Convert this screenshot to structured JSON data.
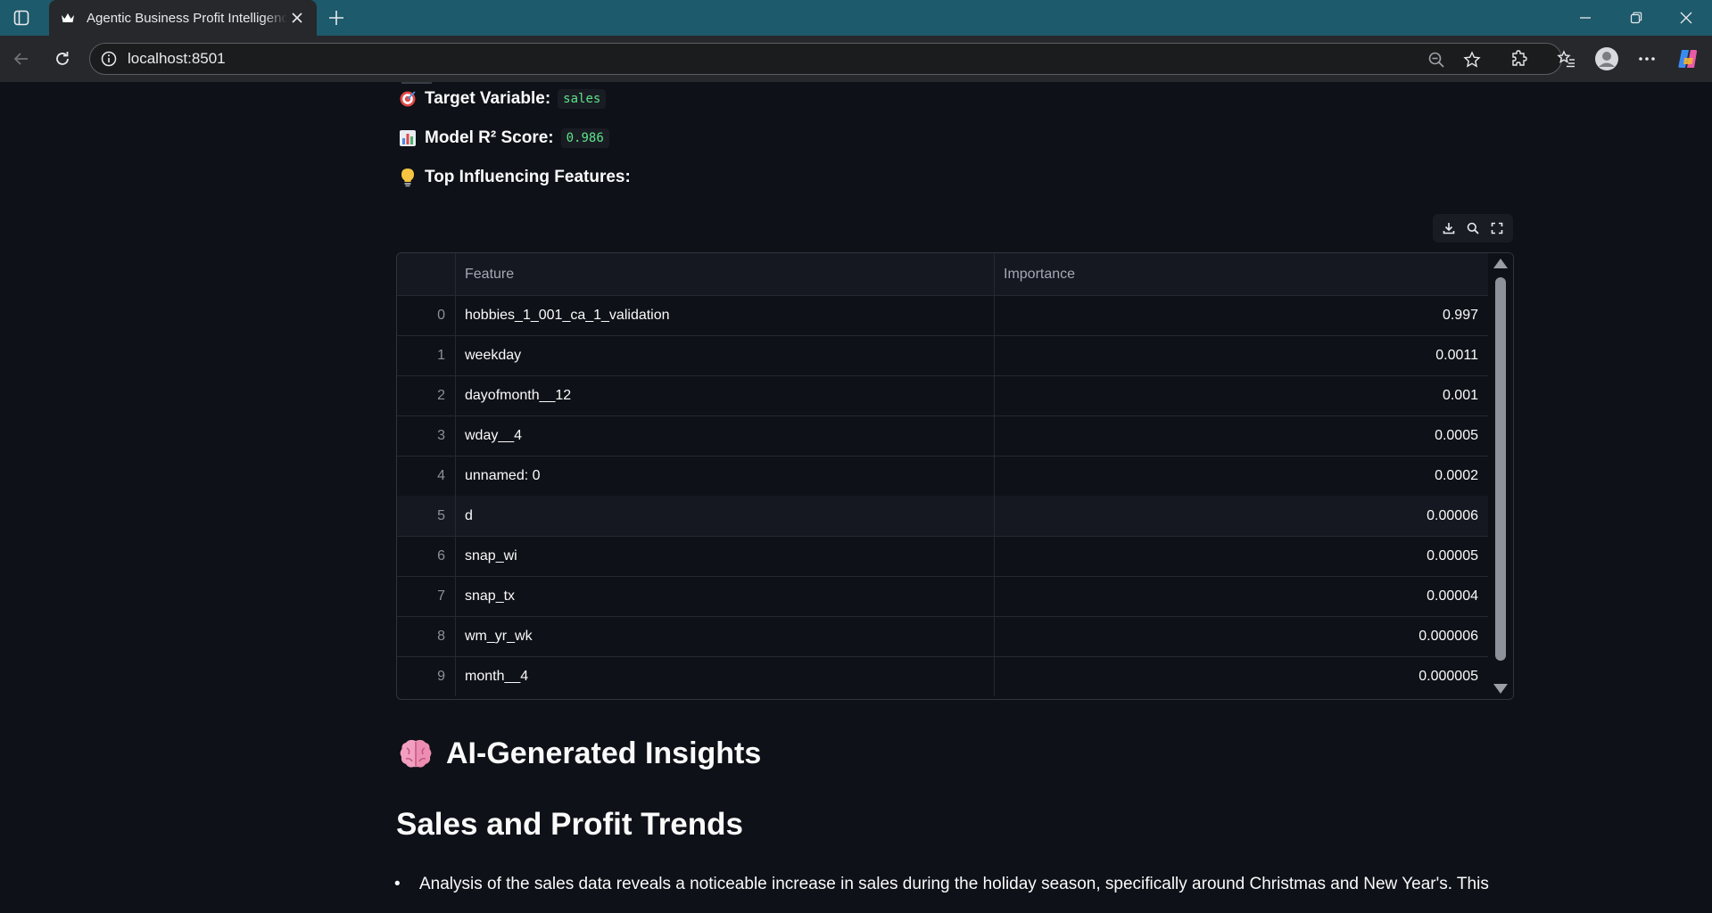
{
  "browser": {
    "tab_title": "Agentic Business Profit Intelligence",
    "url": "localhost:8501"
  },
  "meta": {
    "target_label": "Target Variable:",
    "target_value": "sales",
    "score_label": "Model R² Score:",
    "score_value": "0.986",
    "features_label": "Top Influencing Features:"
  },
  "table": {
    "columns": [
      "Feature",
      "Importance"
    ],
    "rows": [
      {
        "index": "0",
        "feature": "hobbies_1_001_ca_1_validation",
        "importance": "0.997"
      },
      {
        "index": "1",
        "feature": "weekday",
        "importance": "0.0011"
      },
      {
        "index": "2",
        "feature": "dayofmonth__12",
        "importance": "0.001"
      },
      {
        "index": "3",
        "feature": "wday__4",
        "importance": "0.0005"
      },
      {
        "index": "4",
        "feature": "unnamed: 0",
        "importance": "0.0002"
      },
      {
        "index": "5",
        "feature": "d",
        "importance": "0.00006"
      },
      {
        "index": "6",
        "feature": "snap_wi",
        "importance": "0.00005"
      },
      {
        "index": "7",
        "feature": "snap_tx",
        "importance": "0.00004"
      },
      {
        "index": "8",
        "feature": "wm_yr_wk",
        "importance": "0.000006"
      },
      {
        "index": "9",
        "feature": "month__4",
        "importance": "0.000005"
      }
    ]
  },
  "insights": {
    "title": "AI-Generated Insights",
    "section": "Sales and Profit Trends",
    "bullet": "Analysis of the sales data reveals a noticeable increase in sales during the holiday season, specifically around Christmas and New Year's. This"
  },
  "colors": {
    "background": "#0e1117",
    "code_text": "#5ce488",
    "tab_strip": "#1d5a6b"
  }
}
